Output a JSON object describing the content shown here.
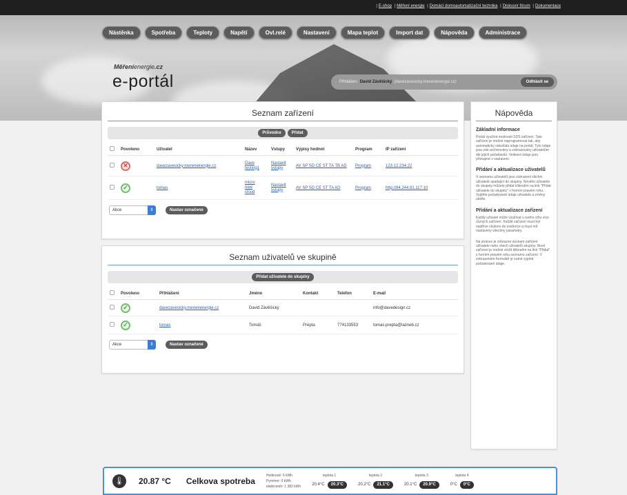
{
  "toplinks": [
    "E-shop",
    "Měření energie",
    "Domácí domoautomatizační technika",
    "Diskusní fórum",
    "Dokumentace"
  ],
  "nav": [
    "Nástěnka",
    "Spotřeba",
    "Teploty",
    "Napětí",
    "Ovl.relé",
    "Nastavení",
    "Mapa teplot",
    "Import dat",
    "Nápověda",
    "Administrace"
  ],
  "logo": {
    "small_bold": "Měření",
    "small_rest": "energie",
    "small_tld": ".cz",
    "big": "e-portál"
  },
  "login": {
    "prefix": "Přihlášen:",
    "name": "David Závěšický",
    "email": "(davezavesicky.merenienergie.cz)",
    "logout": "Odhlásit se"
  },
  "devices": {
    "title": "Seznam zařízení",
    "buttons": [
      "Průvodce",
      "Přidat"
    ],
    "headers": [
      "Povoleno",
      "Uživatel",
      "Název",
      "Vstupy",
      "Výpisy hodnot",
      "Program",
      "IP zařízení"
    ],
    "rows": [
      {
        "status": "✕",
        "user": "davezavesicky.merenienergie.cz",
        "name": "Dave testing1",
        "inputs": "Nastavit vstupy",
        "values": "AV SP SD CE ST TA TB AD",
        "program": "Program",
        "ip": "123.12.234.22"
      },
      {
        "status": "✓",
        "user": "tomas",
        "name": "micro new cloud",
        "inputs": "Nastavit vstupy",
        "values": "AV SP SD CE ST TA AD",
        "program": "Program",
        "ip": "http://84.244.91.117:10"
      }
    ],
    "select": "Akce",
    "apply": "Nastav označené"
  },
  "users": {
    "title": "Seznam uživatelů ve skupině",
    "buttons": [
      "Přidat uživatele do skupiny"
    ],
    "headers": [
      "Povoleno",
      "Přihlášení",
      "Jméno",
      "Kontakt",
      "Telefon",
      "E-mail"
    ],
    "rows": [
      {
        "status": "✓",
        "login": "davezavesicky.merenienergie.cz",
        "name": "David Závěšický",
        "contact": "",
        "phone": "",
        "email": "info@davedesign.cz"
      },
      {
        "status": "✓",
        "login": "tomas",
        "name": "Tomáš",
        "contact": "Prepta",
        "phone": "774133553",
        "email": "tomas.prepta@lazneb.cz"
      }
    ],
    "select": "Akce",
    "apply": "Nastav označené"
  },
  "help": {
    "title": "Nápověda",
    "sections": [
      {
        "heading": "Základní informace",
        "text": "Portál využívá možnosti SDS zařízení. Tato zařízení je možné naprogramovat tak, aby automaticky odesílala údaje na portál. Tyto údaje jsou zde archivovány a zobrazovány uživatelům dle jejich požadavků. Veškeré údaje jsou přístupné v nastavení."
      },
      {
        "heading": "Přidání a aktualizace uživatelů",
        "text": "V seznamu uživatelů jsou zobrazeni všichni uživatelé spadající do skupiny. Nového uživatele do skupiny můžete přidat kliknutím na link \"Přidat uživatele do skupiny\" v horním pravém rohu. Vyplňte požadované údaje uživatele a změny uložte."
      },
      {
        "heading": "Přidání a aktualizace zařízení",
        "text": "Každý uživatel může využívat u svého účtu více různých zařízení. Každé zařízení musí být nejdříve vloženo do evidence a musí mít nastaveny všechny parametry."
      },
      {
        "heading": "",
        "text": "Na stránce je zobrazen seznam zařízení uživatele nebo všech uživatelů skupiny. Nové zařízení je možné vložit kliknutím na link \"Přidat\" v horním pravém rohu seznamu zařízení. V zobrazeném formuláři je nutné vyplnit požadované údaje."
      }
    ]
  },
  "bottom": {
    "temp": "20.87 °C",
    "name": "Celkova spotreba",
    "stats": [
      "Hodinově: 0 kWh",
      "Pyromer: 0 kWh",
      "elektroměr: 1 382 kWh"
    ],
    "sensors": [
      {
        "label": "teplota 1",
        "value": "20.4°C",
        "badge": "20.3°C"
      },
      {
        "label": "teplota 2",
        "value": "20.2°C",
        "badge": "21.1°C"
      },
      {
        "label": "teplota 3",
        "value": "20.1°C",
        "badge": "20.9°C"
      },
      {
        "label": "teplota 4",
        "value": "0°C",
        "badge": "0°C"
      }
    ]
  }
}
